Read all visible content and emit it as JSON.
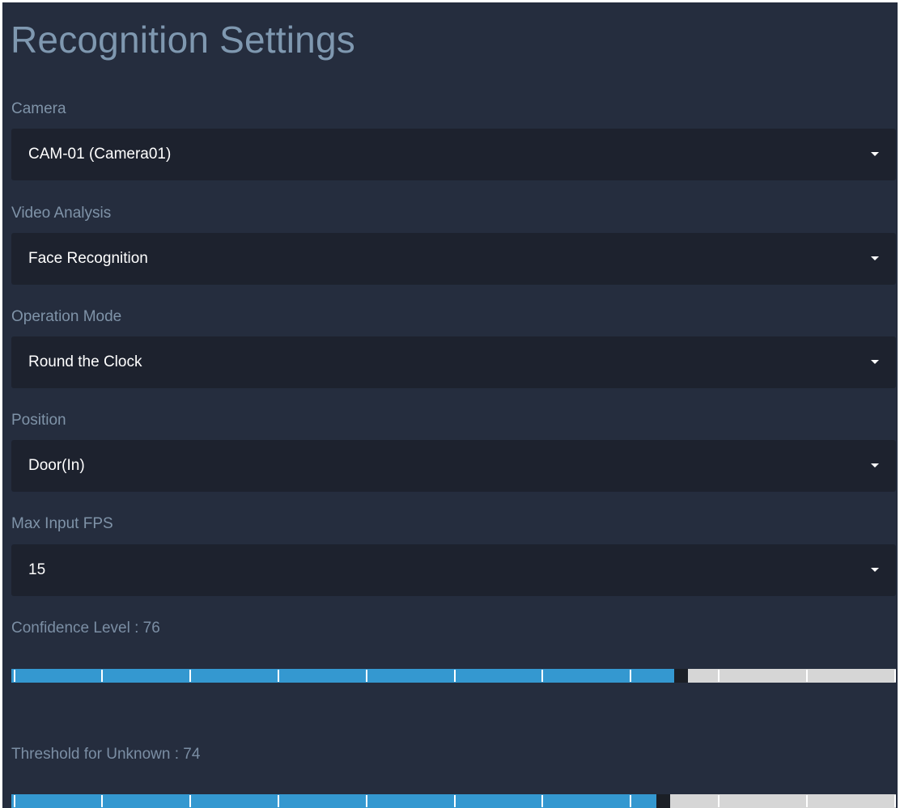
{
  "title": "Recognition Settings",
  "fields": [
    {
      "label": "Camera",
      "value": "CAM-01 (Camera01)"
    },
    {
      "label": "Video Analysis",
      "value": "Face Recognition"
    },
    {
      "label": "Operation Mode",
      "value": "Round the Clock"
    },
    {
      "label": "Position",
      "value": "Door(In)"
    },
    {
      "label": "Max Input FPS",
      "value": "15"
    }
  ],
  "sliders": [
    {
      "label": "Confidence Level : 76",
      "value": 76,
      "min": 0,
      "max": 100
    },
    {
      "label": "Threshold for Unknown : 74",
      "value": 74,
      "min": 0,
      "max": 100
    }
  ],
  "colors": {
    "background": "#252d3e",
    "select_background": "#1d222e",
    "label": "#7f93a8",
    "title": "#7f98b0",
    "slider_fill": "#3498d0",
    "slider_track": "#d6d6d6",
    "slider_thumb": "#1b1f26"
  },
  "icons": {
    "dropdown": "caret-down-icon"
  }
}
